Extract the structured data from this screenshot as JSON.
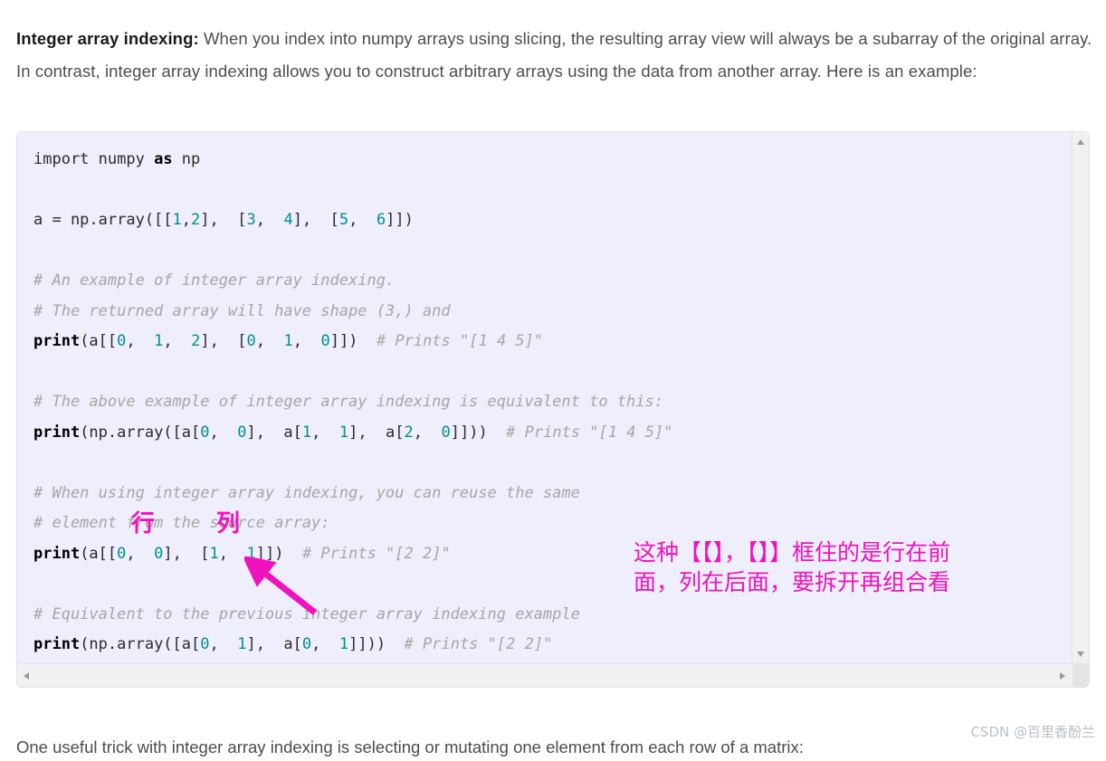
{
  "intro": {
    "lead": "Integer array indexing:",
    "body": " When you index into numpy arrays using slicing, the resulting array view will always be a subarray of the original array. In contrast, integer array indexing allows you to construct arbitrary arrays using the data from another array. Here is an example:"
  },
  "code": {
    "language": "python",
    "lines": [
      [
        {
          "t": "import ",
          "c": "plain"
        },
        {
          "t": "numpy ",
          "c": "plain"
        },
        {
          "t": "as",
          "c": "kw"
        },
        {
          "t": " np",
          "c": "plain"
        }
      ],
      [],
      [
        {
          "t": "a = np.array([[",
          "c": "plain"
        },
        {
          "t": "1",
          "c": "num"
        },
        {
          "t": ",",
          "c": "plain"
        },
        {
          "t": "2",
          "c": "num"
        },
        {
          "t": "],  [",
          "c": "plain"
        },
        {
          "t": "3",
          "c": "num"
        },
        {
          "t": ",  ",
          "c": "plain"
        },
        {
          "t": "4",
          "c": "num"
        },
        {
          "t": "],  [",
          "c": "plain"
        },
        {
          "t": "5",
          "c": "num"
        },
        {
          "t": ",  ",
          "c": "plain"
        },
        {
          "t": "6",
          "c": "num"
        },
        {
          "t": "]])",
          "c": "plain"
        }
      ],
      [],
      [
        {
          "t": "# An example of integer array indexing.",
          "c": "comment"
        }
      ],
      [
        {
          "t": "# The returned array will have shape (3,) and",
          "c": "comment"
        }
      ],
      [
        {
          "t": "print",
          "c": "fn"
        },
        {
          "t": "(a[[",
          "c": "plain"
        },
        {
          "t": "0",
          "c": "num"
        },
        {
          "t": ",  ",
          "c": "plain"
        },
        {
          "t": "1",
          "c": "num"
        },
        {
          "t": ",  ",
          "c": "plain"
        },
        {
          "t": "2",
          "c": "num"
        },
        {
          "t": "],  [",
          "c": "plain"
        },
        {
          "t": "0",
          "c": "num"
        },
        {
          "t": ",  ",
          "c": "plain"
        },
        {
          "t": "1",
          "c": "num"
        },
        {
          "t": ",  ",
          "c": "plain"
        },
        {
          "t": "0",
          "c": "num"
        },
        {
          "t": "]])  ",
          "c": "plain"
        },
        {
          "t": "# Prints \"[1 4 5]\"",
          "c": "comment"
        }
      ],
      [],
      [
        {
          "t": "# The above example of integer array indexing is equivalent to this:",
          "c": "comment"
        }
      ],
      [
        {
          "t": "print",
          "c": "fn"
        },
        {
          "t": "(np.array([a[",
          "c": "plain"
        },
        {
          "t": "0",
          "c": "num"
        },
        {
          "t": ",  ",
          "c": "plain"
        },
        {
          "t": "0",
          "c": "num"
        },
        {
          "t": "],  a[",
          "c": "plain"
        },
        {
          "t": "1",
          "c": "num"
        },
        {
          "t": ",  ",
          "c": "plain"
        },
        {
          "t": "1",
          "c": "num"
        },
        {
          "t": "],  a[",
          "c": "plain"
        },
        {
          "t": "2",
          "c": "num"
        },
        {
          "t": ",  ",
          "c": "plain"
        },
        {
          "t": "0",
          "c": "num"
        },
        {
          "t": "]]))  ",
          "c": "plain"
        },
        {
          "t": "# Prints \"[1 4 5]\"",
          "c": "comment"
        }
      ],
      [],
      [
        {
          "t": "# When using integer array indexing, you can reuse the same",
          "c": "comment"
        }
      ],
      [
        {
          "t": "# element from the source array:",
          "c": "comment"
        }
      ],
      [
        {
          "t": "print",
          "c": "fn"
        },
        {
          "t": "(a[[",
          "c": "plain"
        },
        {
          "t": "0",
          "c": "num"
        },
        {
          "t": ",  ",
          "c": "plain"
        },
        {
          "t": "0",
          "c": "num"
        },
        {
          "t": "],  [",
          "c": "plain"
        },
        {
          "t": "1",
          "c": "num"
        },
        {
          "t": ",  ",
          "c": "plain"
        },
        {
          "t": "1",
          "c": "num"
        },
        {
          "t": "]])  ",
          "c": "plain"
        },
        {
          "t": "# Prints \"[2 2]\"",
          "c": "comment"
        }
      ],
      [],
      [
        {
          "t": "# Equivalent to the previous integer array indexing example",
          "c": "comment"
        }
      ],
      [
        {
          "t": "print",
          "c": "fn"
        },
        {
          "t": "(np.array([a[",
          "c": "plain"
        },
        {
          "t": "0",
          "c": "num"
        },
        {
          "t": ",  ",
          "c": "plain"
        },
        {
          "t": "1",
          "c": "num"
        },
        {
          "t": "],  a[",
          "c": "plain"
        },
        {
          "t": "0",
          "c": "num"
        },
        {
          "t": ",  ",
          "c": "plain"
        },
        {
          "t": "1",
          "c": "num"
        },
        {
          "t": "]]))  ",
          "c": "plain"
        },
        {
          "t": "# Prints \"[2 2]\"",
          "c": "comment"
        }
      ]
    ]
  },
  "annotations": {
    "color": "#f012be",
    "row_label": "行",
    "column_label": "列",
    "note_line1": "这种【【】，【】】框住的是行在前",
    "note_line2": "面，列在后面，要拆开再组合看"
  },
  "scrollbars": {
    "vertical_up_icon": "triangle-up-icon",
    "vertical_down_icon": "triangle-down-icon",
    "horizontal_left_icon": "triangle-left-icon",
    "horizontal_right_icon": "triangle-right-icon"
  },
  "bottom": {
    "paragraph": "One useful trick with integer array indexing is selecting or mutating one element from each row of a matrix:"
  },
  "watermark": {
    "text": "CSDN @百里香酚兰"
  }
}
